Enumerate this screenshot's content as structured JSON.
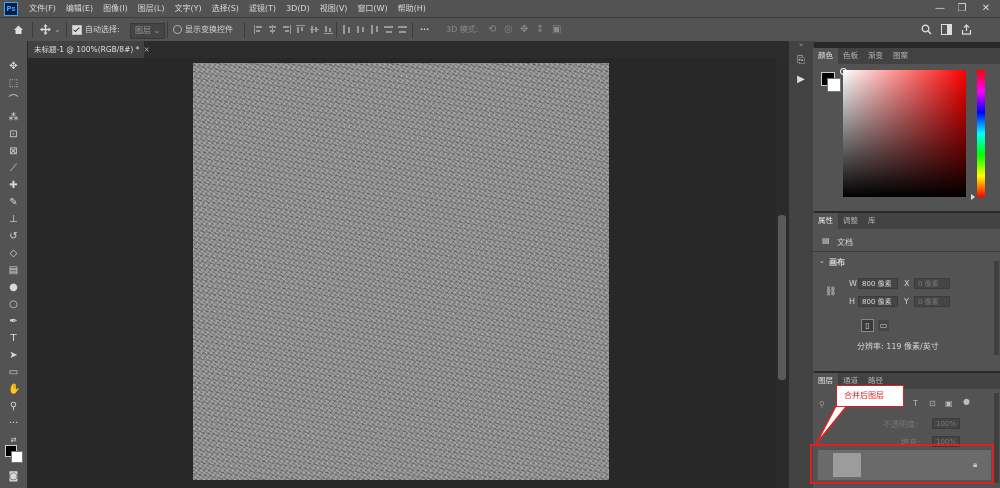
{
  "menu": {
    "logo": "Ps",
    "items": [
      "文件(F)",
      "编辑(E)",
      "图像(I)",
      "图层(L)",
      "文字(Y)",
      "选择(S)",
      "滤镜(T)",
      "3D(D)",
      "视图(V)",
      "窗口(W)",
      "帮助(H)"
    ]
  },
  "window_controls": {
    "minimize": "—",
    "restore": "❐",
    "close": "✕"
  },
  "options": {
    "auto_select_label": "自动选择:",
    "auto_select_target": "图层",
    "show_transform_label": "显示变换控件",
    "mode_3d_label": "3D 模式:",
    "more": "···"
  },
  "document": {
    "tab_title": "未标题-1 @ 100%(RGB/8#) *"
  },
  "color_panel": {
    "tabs": [
      "颜色",
      "色板",
      "渐变",
      "图案"
    ],
    "hue_color": "#ff0000"
  },
  "properties_panel": {
    "tabs": [
      "属性",
      "调整",
      "库"
    ],
    "doc_label": "文档",
    "section_title": "画布",
    "w_label": "W",
    "w_value": "800 像素",
    "h_label": "H",
    "h_value": "800 像素",
    "x_label": "X",
    "x_value": "0 像素",
    "y_label": "Y",
    "y_value": "0 像素",
    "resolution": "分辨率: 119 像素/英寸"
  },
  "layers_panel": {
    "tabs": [
      "图层",
      "通道",
      "路径"
    ],
    "opacity_label": "不透明度:",
    "opacity_value": "100%",
    "fill_label": "填充:",
    "fill_value": "100%",
    "callout_text": "合并后图层"
  },
  "colors": {
    "accent": "#31a8ff",
    "annotation": "#e02020"
  }
}
